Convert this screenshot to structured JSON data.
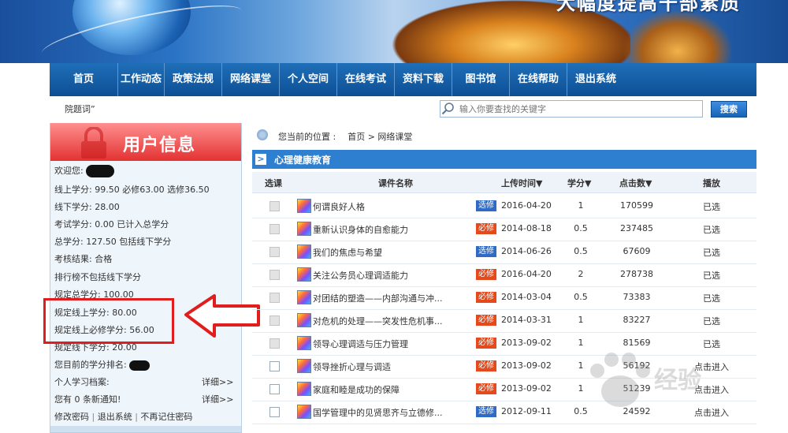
{
  "banner": {
    "title": "大幅度提高干部素质"
  },
  "nav": {
    "items": [
      "首页",
      "工作动态",
      "政策法规",
      "网络课堂",
      "个人空间",
      "在线考试",
      "资料下载",
      "图书馆",
      "在线帮助",
      "退出系统"
    ]
  },
  "notice": "院题词”",
  "search": {
    "placeholder": "输入你要查找的关键字",
    "button": "搜索"
  },
  "sidebar": {
    "title": "用户信息",
    "welcome": "欢迎您:",
    "online_credits": "线上学分: 99.50  必修63.00  选修36.50",
    "offline_credits": "线下学分: 28.00",
    "exam_credits": "考试学分: 0.00 已计入总学分",
    "total_credits": "总学分: 127.50 包括线下学分",
    "assessment": "考核结果: 合格",
    "ranking_note": "排行榜不包括线下学分",
    "required_total": "规定总学分: 100.00",
    "required_online": "规定线上学分: 80.00",
    "required_online_compulsory": "规定线上必修学分: 56.00",
    "required_offline": "规定线下学分: 20.00",
    "rank": "您目前的学分排名:",
    "profile": "个人学习档案:",
    "profile_link": "详细>>",
    "notifications": "您有 0 条新通知!",
    "notifications_link": "详细>>",
    "links": [
      "修改密码",
      "退出系统",
      "不再记住密码"
    ]
  },
  "breadcrumb": {
    "prefix": "您当前的位置 :",
    "home": "首页",
    "sep": ">",
    "current": "网络课堂"
  },
  "section": {
    "title": "心理健康教育"
  },
  "table": {
    "headers": [
      "选课",
      "课件名称",
      "上传时间▼",
      "学分▼",
      "点击数▼",
      "播放"
    ],
    "rows": [
      {
        "name": "何谓良好人格",
        "type": "选修",
        "date": "2016-04-20",
        "credit": "1",
        "clicks": "170599",
        "status": "已选"
      },
      {
        "name": "重新认识身体的自愈能力",
        "type": "必修",
        "date": "2014-08-18",
        "credit": "0.5",
        "clicks": "237485",
        "status": "已选"
      },
      {
        "name": "我们的焦虑与希望",
        "type": "选修",
        "date": "2014-06-26",
        "credit": "0.5",
        "clicks": "67609",
        "status": "已选"
      },
      {
        "name": "关注公务员心理调适能力",
        "type": "必修",
        "date": "2016-04-20",
        "credit": "2",
        "clicks": "278738",
        "status": "已选"
      },
      {
        "name": "对团结的塑造——内部沟通与冲...",
        "type": "必修",
        "date": "2014-03-04",
        "credit": "0.5",
        "clicks": "73383",
        "status": "已选"
      },
      {
        "name": "对危机的处理——突发性危机事...",
        "type": "必修",
        "date": "2014-03-31",
        "credit": "1",
        "clicks": "83227",
        "status": "已选"
      },
      {
        "name": "领导心理调适与压力管理",
        "type": "必修",
        "date": "2013-09-02",
        "credit": "1",
        "clicks": "81569",
        "status": "已选"
      },
      {
        "name": "领导挫折心理与调适",
        "type": "必修",
        "date": "2013-09-02",
        "credit": "1",
        "clicks": "56192",
        "status": "点击进入"
      },
      {
        "name": "家庭和睦是成功的保障",
        "type": "必修",
        "date": "2013-09-02",
        "credit": "1",
        "clicks": "51239",
        "status": "点击进入"
      },
      {
        "name": "国学管理中的见贤思齐与立德修...",
        "type": "选修",
        "date": "2012-09-11",
        "credit": "0.5",
        "clicks": "24592",
        "status": "点击进入"
      }
    ]
  },
  "colors": {
    "nav": "#0d4f95",
    "accent": "#2f7fd0",
    "elective": "#2f6bc4",
    "compulsory": "#e54a1c",
    "highlight": "#e21d1d"
  }
}
